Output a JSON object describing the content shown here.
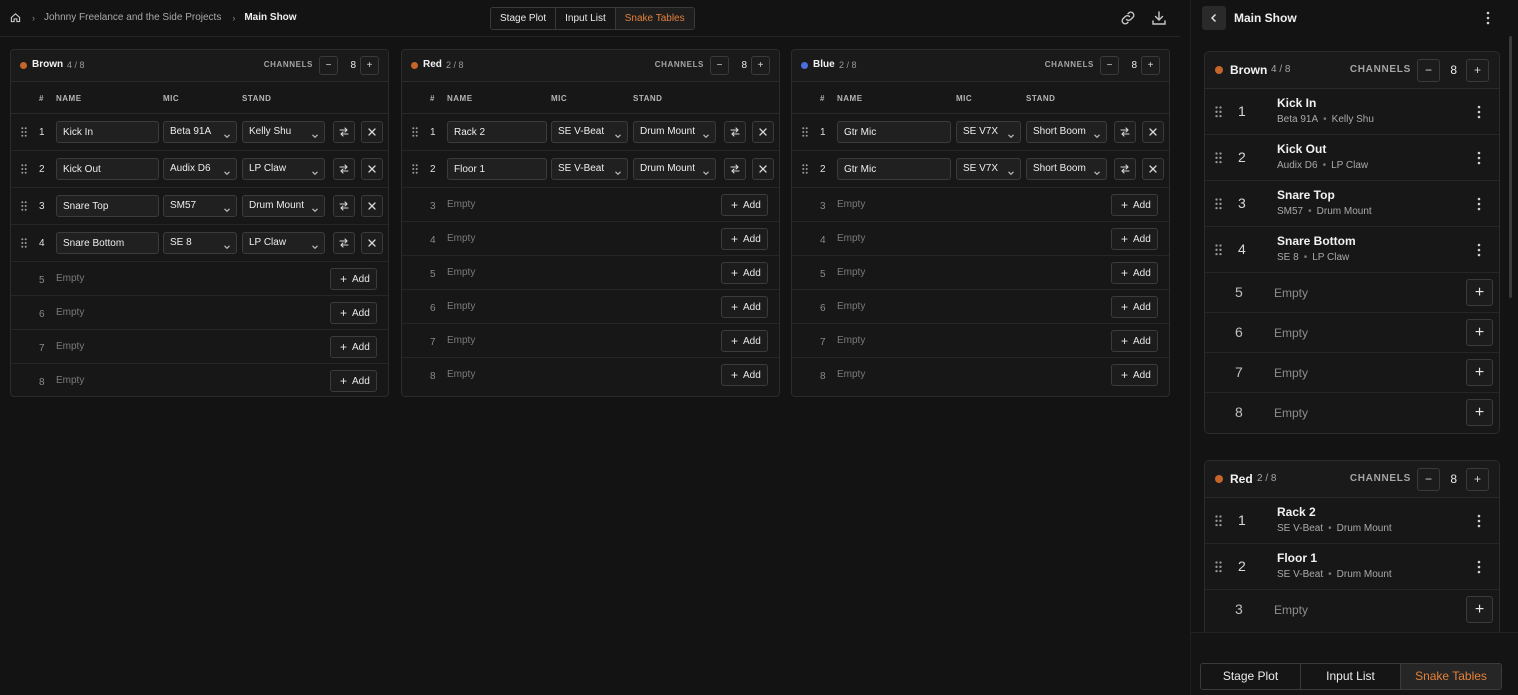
{
  "breadcrumb": {
    "home_icon": "home-icon",
    "project": "Johnny Freelance and the Side Projects",
    "current": "Main Show"
  },
  "view_tabs": [
    "Stage Plot",
    "Input List",
    "Snake Tables"
  ],
  "active_view": "Snake Tables",
  "columns": {
    "num": "#",
    "name": "NAME",
    "mic": "MIC",
    "stand": "STAND"
  },
  "channels_label": "CHANNELS",
  "empty_label": "Empty",
  "add_label": "Add",
  "snakes": [
    {
      "name": "Brown",
      "color": "#c4652a",
      "used": "4 / 8",
      "channels": "8",
      "rows": [
        {
          "num": "1",
          "name": "Kick In",
          "mic": "Beta 91A",
          "stand": "Kelly Shu"
        },
        {
          "num": "2",
          "name": "Kick Out",
          "mic": "Audix D6",
          "stand": "LP Claw"
        },
        {
          "num": "3",
          "name": "Snare Top",
          "mic": "SM57",
          "stand": "Drum Mount"
        },
        {
          "num": "4",
          "name": "Snare Bottom",
          "mic": "SE 8",
          "stand": "LP Claw"
        }
      ],
      "empty_rows": [
        "5",
        "6",
        "7",
        "8"
      ]
    },
    {
      "name": "Red",
      "color": "#c4652a",
      "used": "2 / 8",
      "channels": "8",
      "rows": [
        {
          "num": "1",
          "name": "Rack 2",
          "mic": "SE V-Beat",
          "stand": "Drum Mount"
        },
        {
          "num": "2",
          "name": "Floor 1",
          "mic": "SE V-Beat",
          "stand": "Drum Mount"
        }
      ],
      "empty_rows": [
        "3",
        "4",
        "5",
        "6",
        "7",
        "8"
      ]
    },
    {
      "name": "Blue",
      "color": "#4a6de0",
      "used": "2 / 8",
      "channels": "8",
      "rows": [
        {
          "num": "1",
          "name": "Gtr Mic",
          "mic": "SE V7X",
          "stand": "Short Boom"
        },
        {
          "num": "2",
          "name": "Gtr Mic",
          "mic": "SE V7X",
          "stand": "Short Boom"
        }
      ],
      "empty_rows": [
        "3",
        "4",
        "5",
        "6",
        "7",
        "8"
      ]
    }
  ],
  "panel": {
    "title": "Main Show",
    "bottom_tabs": [
      "Stage Plot",
      "Input List",
      "Snake Tables"
    ],
    "mobile_empty_rows": {
      "brown": [
        "5",
        "6",
        "7",
        "8"
      ],
      "red": [
        "3"
      ]
    }
  }
}
